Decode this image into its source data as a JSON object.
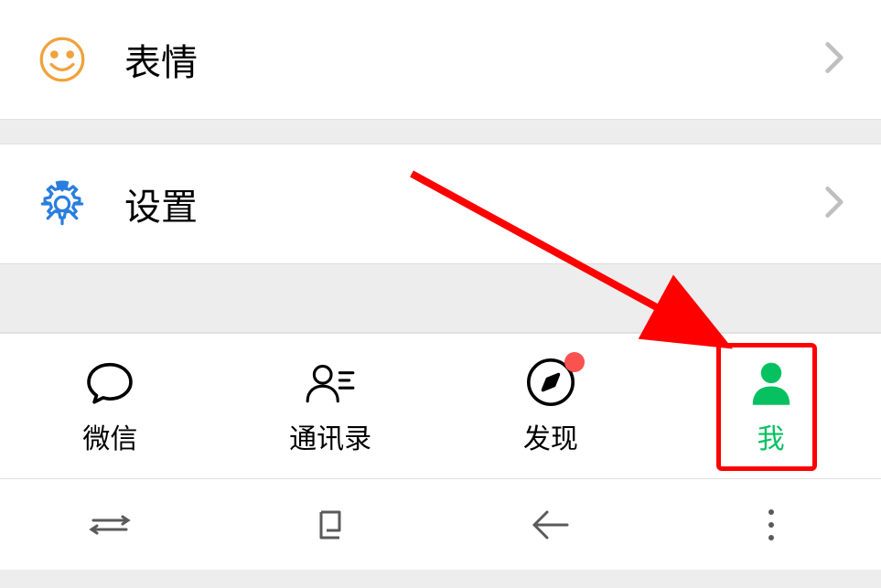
{
  "list": {
    "emoji": {
      "label": "表情"
    },
    "settings": {
      "label": "设置"
    }
  },
  "tabs": {
    "wechat": {
      "label": "微信"
    },
    "contacts": {
      "label": "通讯录"
    },
    "discover": {
      "label": "发现",
      "badge": true
    },
    "me": {
      "label": "我",
      "active": true
    }
  },
  "colors": {
    "accent": "#07c160",
    "emoji_icon": "#f0a23c",
    "settings_icon": "#2a7fde",
    "badge": "#fa5151",
    "annotation": "#ff0000"
  }
}
